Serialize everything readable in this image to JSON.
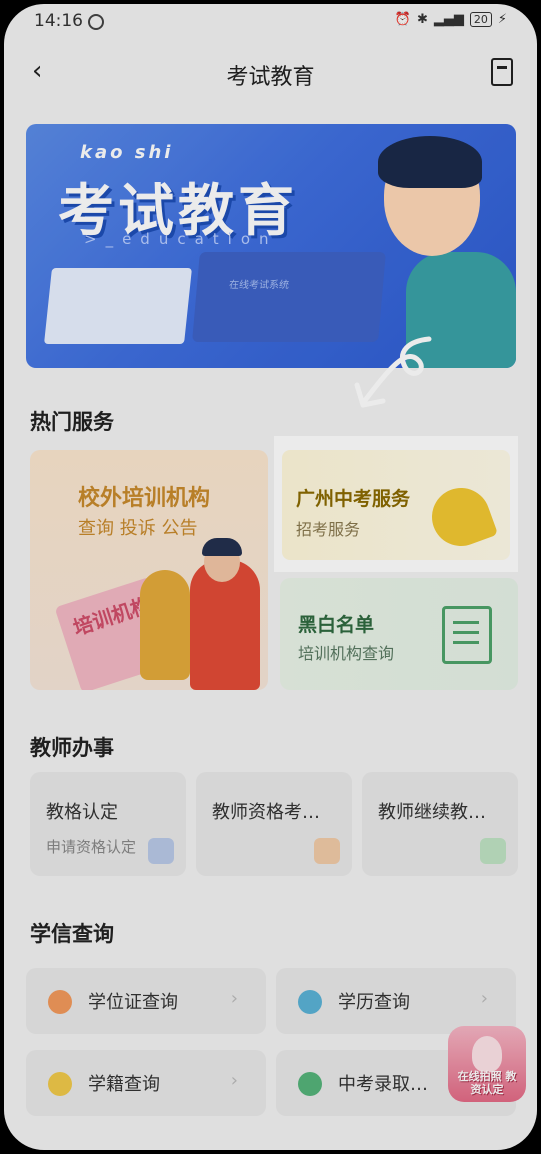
{
  "status": {
    "time": "14:16",
    "battery": "20"
  },
  "nav": {
    "title": "考试教育"
  },
  "banner": {
    "pinyin": "kao shi",
    "title": "考试教育",
    "edu": ">_education",
    "screen_text": "在线考试系统"
  },
  "hot_services": {
    "section_title": "热门服务",
    "left_card": {
      "title": "校外培训机构",
      "subtitle": "查询 投诉 公告",
      "poster_text": "培训机构"
    },
    "highlight_card": {
      "title": "广州中考服务",
      "subtitle": "招考服务"
    },
    "bw_card": {
      "title": "黑白名单",
      "subtitle": "培训机构查询"
    }
  },
  "teacher": {
    "section_title": "教师办事",
    "cards": [
      {
        "title": "教格认定",
        "subtitle": "申请资格认定"
      },
      {
        "title": "教师资格考…",
        "subtitle": ""
      },
      {
        "title": "教师继续教…",
        "subtitle": ""
      }
    ]
  },
  "xuexin": {
    "section_title": "学信查询",
    "items": [
      {
        "label": "学位证查询"
      },
      {
        "label": "学历查询"
      },
      {
        "label": "学籍查询"
      },
      {
        "label": "中考录取…"
      }
    ]
  },
  "float_badge": {
    "text": "在线拍照 教资认定"
  },
  "colors": {
    "accent": "#3f6fe0",
    "highlight": "#8a6a00",
    "green": "#4ea36a"
  }
}
